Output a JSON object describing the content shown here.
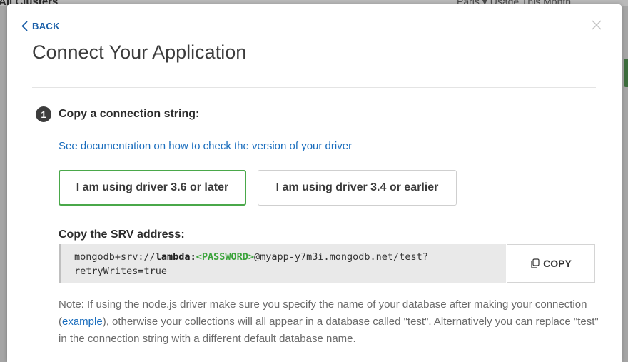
{
  "background": {
    "title": "All Clusters",
    "right_text": "Paris ▾    Usage This Month"
  },
  "modal": {
    "back_label": "BACK",
    "title": "Connect Your Application"
  },
  "step": {
    "number": "1",
    "label": "Copy a connection string:"
  },
  "doc_link": "See documentation on how to check the version of your driver",
  "driver_options": [
    {
      "label": "I am using driver 3.6 or later",
      "selected": true
    },
    {
      "label": "I am using driver 3.4 or earlier",
      "selected": false
    }
  ],
  "srv": {
    "label": "Copy the SRV address:",
    "prefix": "mongodb+srv://",
    "user": "lambda",
    "colon": ":",
    "password": "<PASSWORD>",
    "host": "@myapp-y7m3i.mongodb.net/test?",
    "line2": "retryWrites=true",
    "copy_label": "COPY"
  },
  "note": {
    "part1": "Note: If using the node.js driver make sure you specify the name of your database after making your connection (",
    "link": "example",
    "part2": "), otherwise your collections will all appear in a database called \"test\". Alternatively you can replace \"test\" in the connection string with a different default database name."
  },
  "colors": {
    "accent_green": "#4aa84a",
    "link_blue": "#1a6dbd",
    "password_green": "#3aa33a"
  },
  "icons": [
    "chevron-left-icon",
    "close-icon",
    "copy-icon"
  ]
}
